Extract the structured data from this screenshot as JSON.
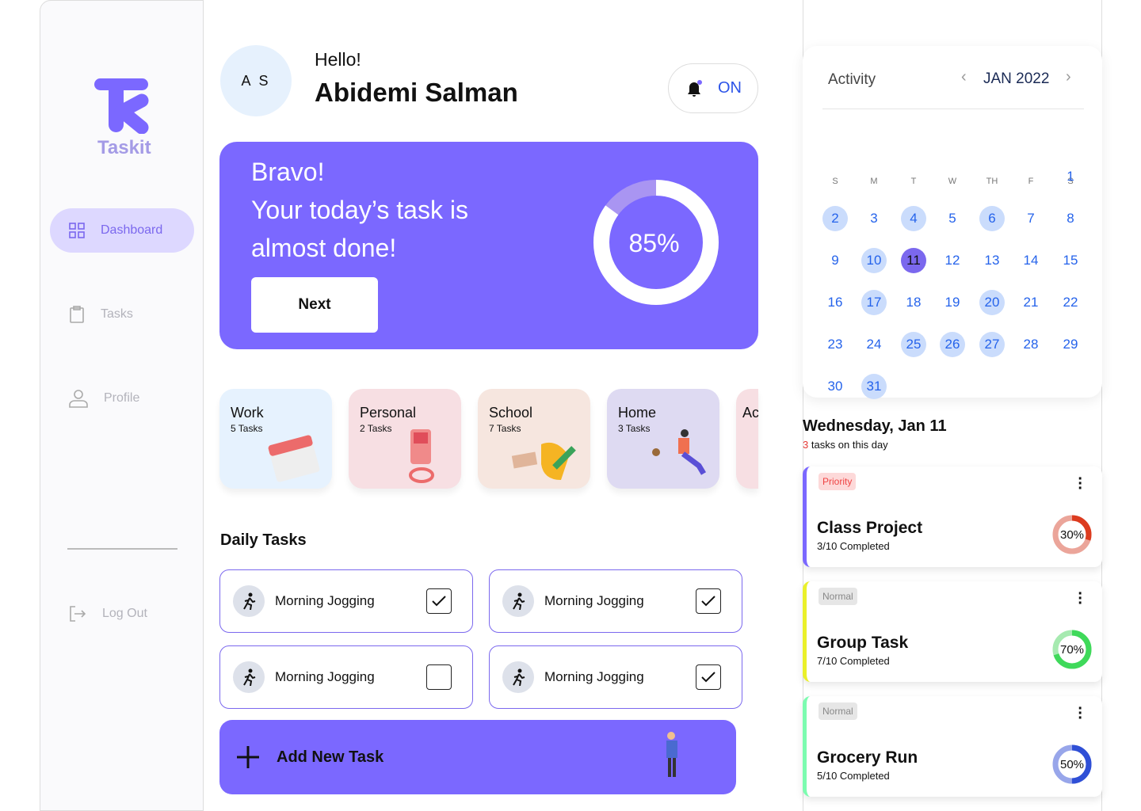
{
  "brand": {
    "name": "Taskit",
    "color": "#7b68ff"
  },
  "sidebar": {
    "items": [
      {
        "label": "Dashboard",
        "icon": "grid-icon",
        "active": true
      },
      {
        "label": "Tasks",
        "icon": "clipboard-icon"
      },
      {
        "label": "Profile",
        "icon": "user-icon"
      }
    ],
    "logout": "Log Out"
  },
  "header": {
    "initials": "A S",
    "greeting": "Hello!",
    "name": "Abidemi Salman",
    "notification_state": "ON"
  },
  "banner": {
    "line1": "Bravo!",
    "line2": "Your today’s task is",
    "line3": "almost done!",
    "button": "Next",
    "progress_label": "85%",
    "progress": 85
  },
  "categories": [
    {
      "title": "Work",
      "count": "5 Tasks",
      "bg": "#e6f2fe"
    },
    {
      "title": "Personal",
      "count": "2 Tasks",
      "bg": "#f7dfe3"
    },
    {
      "title": "School",
      "count": "7 Tasks",
      "bg": "#f6e6df"
    },
    {
      "title": "Home",
      "count": "3 Tasks",
      "bg": "#dedaf2"
    },
    {
      "title": "Ac",
      "count": "",
      "bg": "#f7dfe3"
    }
  ],
  "daily": {
    "title": "Daily Tasks",
    "tasks": [
      {
        "label": "Morning Jogging",
        "checked": true
      },
      {
        "label": "Morning Jogging",
        "checked": true
      },
      {
        "label": "Morning Jogging",
        "checked": false
      },
      {
        "label": "Morning Jogging",
        "checked": true
      }
    ],
    "add": "Add New Task"
  },
  "calendar": {
    "title": "Activity",
    "month": "JAN 2022",
    "weekdays": [
      "S",
      "M",
      "T",
      "W",
      "TH",
      "F",
      "S"
    ],
    "highlighted": [
      2,
      4,
      6,
      10,
      17,
      20,
      25,
      26,
      27,
      31
    ],
    "selected": 11,
    "days": 31
  },
  "day_detail": {
    "title": "Wednesday, Jan 11",
    "count": "3",
    "count_suffix": " tasks on this day"
  },
  "cards": [
    {
      "tag": "Priority",
      "title": "Class Project",
      "sub": "3/10 Completed",
      "pct_label": "30%",
      "pct": 30,
      "accent": "#7b68ff",
      "tag_bg": "#fdd9d9",
      "tag_fg": "#ef4444",
      "ring": "#dc3b1f",
      "ring_bg": "#eba59a"
    },
    {
      "tag": "Normal",
      "title": "Group Task",
      "sub": "7/10 Completed",
      "pct_label": "70%",
      "pct": 70,
      "accent": "#eaf02a",
      "tag_bg": "#e6e6e6",
      "tag_fg": "#888",
      "ring": "#3fd95a",
      "ring_bg": "#a6eab0"
    },
    {
      "tag": "Normal",
      "title": "Grocery Run",
      "sub": "5/10 Completed",
      "pct_label": "50%",
      "pct": 50,
      "accent": "#7cfcb0",
      "tag_bg": "#e6e6e6",
      "tag_fg": "#888",
      "ring": "#2f4fd6",
      "ring_bg": "#98a6ea"
    }
  ]
}
